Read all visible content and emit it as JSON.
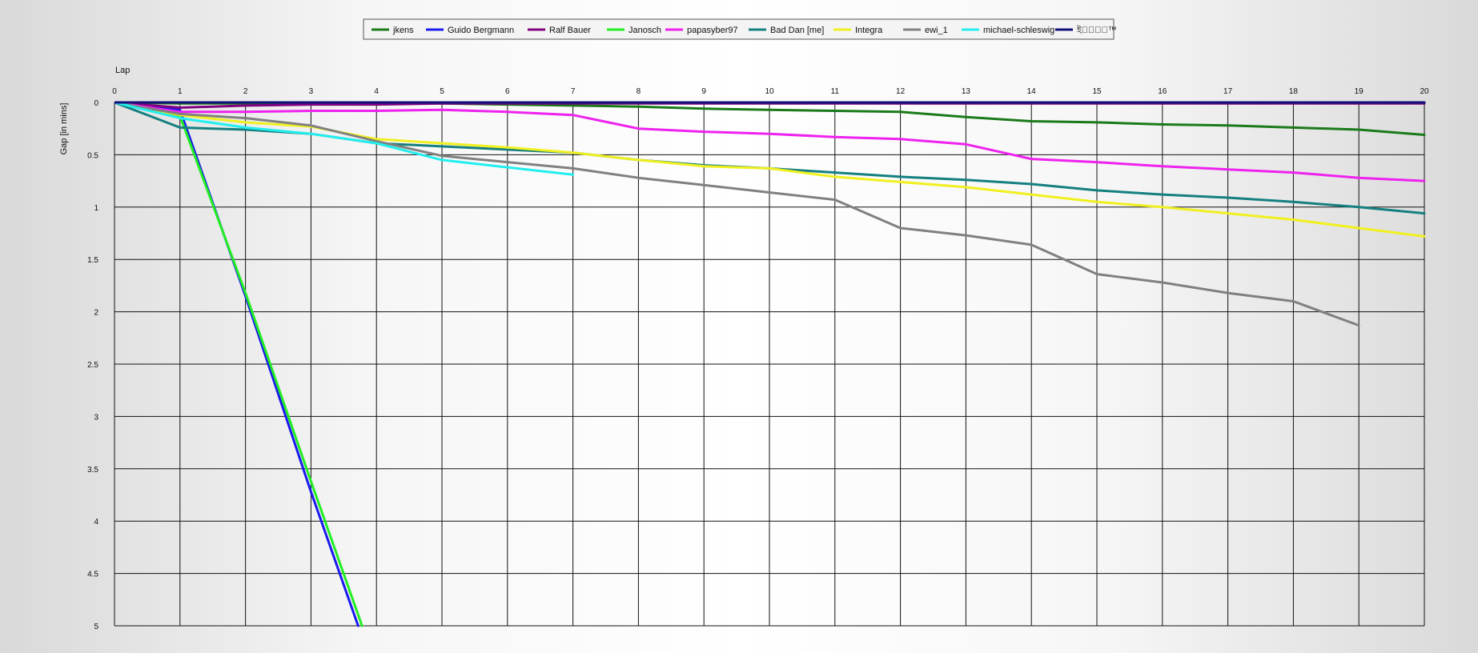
{
  "chart_data": {
    "type": "line",
    "xlabel": "Lap",
    "ylabel": "Gap [in mins]",
    "x_ticks": [
      "0",
      "1",
      "2",
      "3",
      "4",
      "5",
      "6",
      "7",
      "8",
      "9",
      "10",
      "11",
      "12",
      "13",
      "14",
      "15",
      "16",
      "17",
      "18",
      "19",
      "20"
    ],
    "y_ticks": [
      "0",
      "0.5",
      "1",
      "1.5",
      "2",
      "2.5",
      "3",
      "3.5",
      "4",
      "4.5",
      "5"
    ],
    "xlim": [
      0,
      20
    ],
    "ylim": [
      0,
      5
    ],
    "y_inverted": true,
    "grid": true,
    "legend_position": "top-center",
    "series": [
      {
        "name": "jkens",
        "color": "#1a7a1a",
        "points": [
          [
            0,
            0
          ],
          [
            1,
            0.01
          ],
          [
            2,
            0.01
          ],
          [
            3,
            0.01
          ],
          [
            4,
            0.01
          ],
          [
            5,
            0.01
          ],
          [
            6,
            0.02
          ],
          [
            7,
            0.03
          ],
          [
            8,
            0.04
          ],
          [
            9,
            0.06
          ],
          [
            10,
            0.07
          ],
          [
            11,
            0.08
          ],
          [
            12,
            0.09
          ],
          [
            13,
            0.14
          ],
          [
            14,
            0.18
          ],
          [
            15,
            0.19
          ],
          [
            16,
            0.21
          ],
          [
            17,
            0.22
          ],
          [
            18,
            0.24
          ],
          [
            19,
            0.26
          ],
          [
            20,
            0.31
          ]
        ]
      },
      {
        "name": "Guido Bergmann",
        "color": "#1a1aee",
        "points": [
          [
            0,
            0
          ],
          [
            1,
            0.07
          ],
          [
            2,
            1.85
          ],
          [
            3,
            3.72
          ],
          [
            3.72,
            5
          ]
        ]
      },
      {
        "name": "Ralf Bauer",
        "color": "#800080",
        "points": [
          [
            0,
            0
          ],
          [
            1,
            0.05
          ],
          [
            2,
            0.03
          ],
          [
            3,
            0.02
          ],
          [
            4,
            0.02
          ],
          [
            5,
            0.01
          ],
          [
            6,
            0.01
          ],
          [
            7,
            0.01
          ],
          [
            8,
            0.01
          ],
          [
            9,
            0.01
          ],
          [
            10,
            0.01
          ],
          [
            11,
            0.01
          ],
          [
            12,
            0.01
          ],
          [
            13,
            0.01
          ],
          [
            14,
            0.01
          ],
          [
            15,
            0.01
          ],
          [
            16,
            0.01
          ],
          [
            17,
            0.01
          ],
          [
            18,
            0.01
          ],
          [
            19,
            0.01
          ],
          [
            20,
            0.01
          ]
        ]
      },
      {
        "name": "Janosch",
        "color": "#22ee22",
        "points": [
          [
            0,
            0
          ],
          [
            1,
            0.13
          ],
          [
            2,
            1.82
          ],
          [
            3,
            3.62
          ],
          [
            3.78,
            5
          ]
        ]
      },
      {
        "name": "papasyber97",
        "color": "#ee22ee",
        "points": [
          [
            0,
            0
          ],
          [
            1,
            0.09
          ],
          [
            2,
            0.09
          ],
          [
            3,
            0.08
          ],
          [
            4,
            0.08
          ],
          [
            5,
            0.07
          ],
          [
            6,
            0.09
          ],
          [
            7,
            0.12
          ],
          [
            8,
            0.25
          ],
          [
            9,
            0.28
          ],
          [
            10,
            0.3
          ],
          [
            11,
            0.33
          ],
          [
            12,
            0.35
          ],
          [
            13,
            0.4
          ],
          [
            14,
            0.54
          ],
          [
            15,
            0.57
          ],
          [
            16,
            0.61
          ],
          [
            17,
            0.64
          ],
          [
            18,
            0.67
          ],
          [
            19,
            0.72
          ],
          [
            20,
            0.75
          ]
        ]
      },
      {
        "name": "Bad Dan [me]",
        "color": "#157f7f",
        "points": [
          [
            0,
            0
          ],
          [
            1,
            0.24
          ],
          [
            2,
            0.26
          ],
          [
            3,
            0.3
          ],
          [
            4,
            0.39
          ],
          [
            5,
            0.42
          ],
          [
            6,
            0.45
          ],
          [
            7,
            0.48
          ],
          [
            8,
            0.55
          ],
          [
            9,
            0.6
          ],
          [
            10,
            0.63
          ],
          [
            11,
            0.67
          ],
          [
            12,
            0.71
          ],
          [
            13,
            0.74
          ],
          [
            14,
            0.78
          ],
          [
            15,
            0.84
          ],
          [
            16,
            0.88
          ],
          [
            17,
            0.91
          ],
          [
            18,
            0.95
          ],
          [
            19,
            1.0
          ],
          [
            20,
            1.06
          ]
        ]
      },
      {
        "name": "Integra",
        "color": "#f0f020",
        "points": [
          [
            0,
            0
          ],
          [
            1,
            0.12
          ],
          [
            2,
            0.19
          ],
          [
            3,
            0.23
          ],
          [
            4,
            0.35
          ],
          [
            5,
            0.39
          ],
          [
            6,
            0.43
          ],
          [
            7,
            0.48
          ],
          [
            8,
            0.55
          ],
          [
            9,
            0.61
          ],
          [
            10,
            0.63
          ],
          [
            11,
            0.71
          ],
          [
            12,
            0.76
          ],
          [
            13,
            0.81
          ],
          [
            14,
            0.88
          ],
          [
            15,
            0.95
          ],
          [
            16,
            1.0
          ],
          [
            17,
            1.06
          ],
          [
            18,
            1.12
          ],
          [
            19,
            1.2
          ],
          [
            20,
            1.28
          ]
        ]
      },
      {
        "name": "ewi_1",
        "color": "#808080",
        "points": [
          [
            0,
            0
          ],
          [
            1,
            0.11
          ],
          [
            2,
            0.15
          ],
          [
            3,
            0.22
          ],
          [
            4,
            0.37
          ],
          [
            5,
            0.51
          ],
          [
            6,
            0.57
          ],
          [
            7,
            0.63
          ],
          [
            8,
            0.72
          ],
          [
            9,
            0.79
          ],
          [
            10,
            0.86
          ],
          [
            11,
            0.93
          ],
          [
            12,
            1.2
          ],
          [
            13,
            1.27
          ],
          [
            14,
            1.36
          ],
          [
            15,
            1.64
          ],
          [
            16,
            1.72
          ],
          [
            17,
            1.82
          ],
          [
            18,
            1.9
          ],
          [
            19,
            2.13
          ]
        ]
      },
      {
        "name": "michael-schleswig",
        "color": "#22eeee",
        "points": [
          [
            0,
            0
          ],
          [
            1,
            0.15
          ],
          [
            2,
            0.24
          ],
          [
            3,
            0.3
          ],
          [
            4,
            0.39
          ],
          [
            5,
            0.55
          ],
          [
            6,
            0.62
          ],
          [
            7,
            0.69
          ]
        ]
      },
      {
        "name": "ই‍য়ে্‍™",
        "color": "#10107a",
        "points": [
          [
            0,
            0
          ],
          [
            20,
            0
          ]
        ]
      }
    ]
  }
}
